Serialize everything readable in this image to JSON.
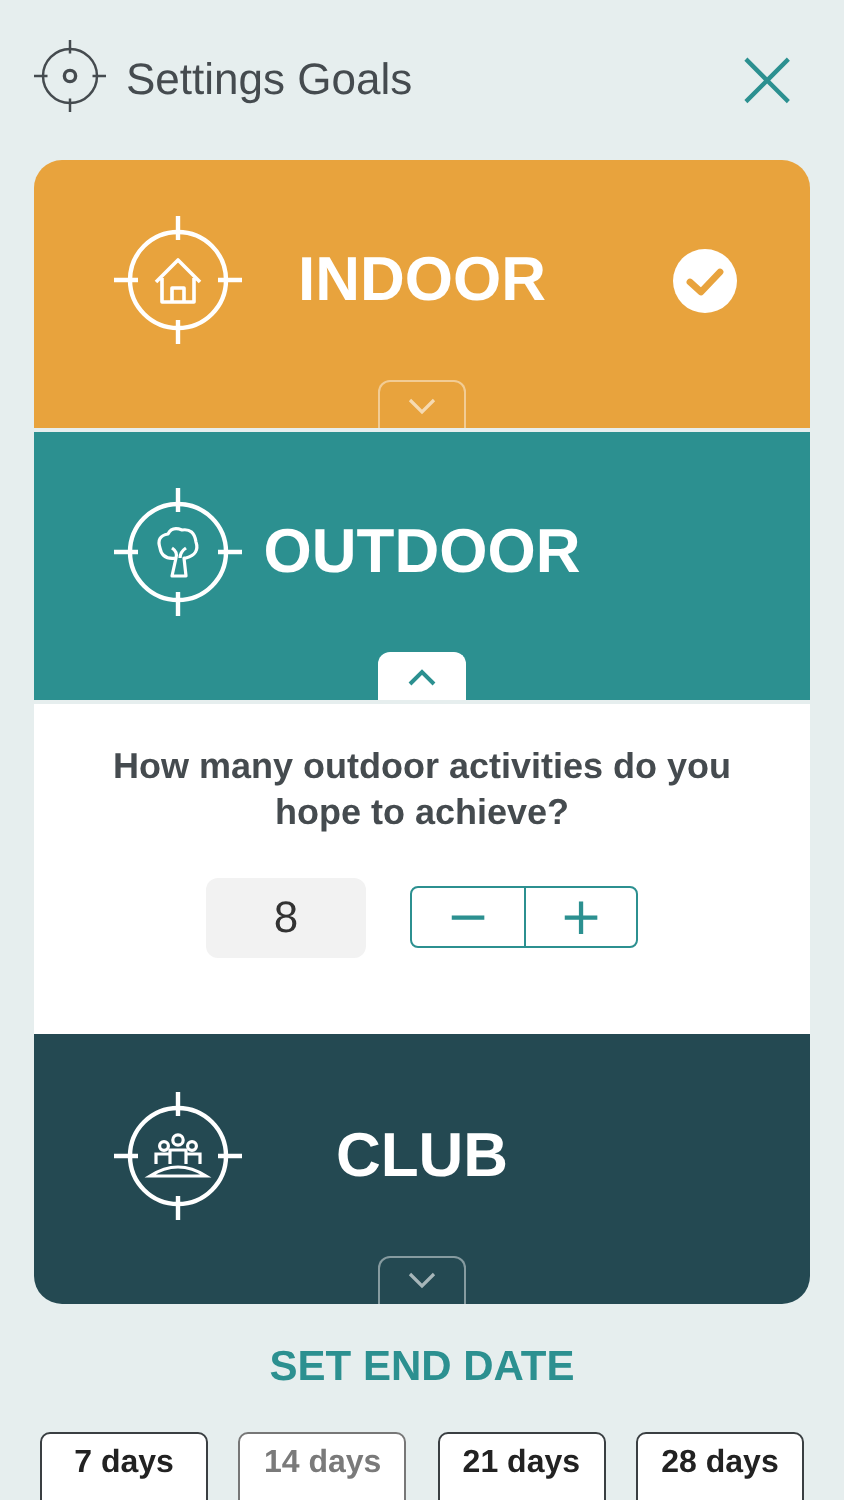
{
  "header": {
    "title": "Settings Goals",
    "close": "×"
  },
  "goals": [
    {
      "kind": "home",
      "label": "INDOOR",
      "color": "#e8a33d",
      "checked": true,
      "expanded": false
    },
    {
      "kind": "tree",
      "label": "OUTDOOR",
      "color": "#2c9090",
      "checked": false,
      "expanded": true,
      "question": "How many outdoor activities do you hope to achieve?",
      "value": "8",
      "minus": "−",
      "plus": "+"
    },
    {
      "kind": "group",
      "label": "CLUB",
      "color": "#244952",
      "checked": false,
      "expanded": false
    }
  ],
  "end_date": {
    "title": "SET END DATE",
    "options": [
      {
        "label": "7 days",
        "disabled": false
      },
      {
        "label": "14 days",
        "disabled": true
      },
      {
        "label": "21 days",
        "disabled": false
      },
      {
        "label": "28 days",
        "disabled": false
      }
    ]
  }
}
